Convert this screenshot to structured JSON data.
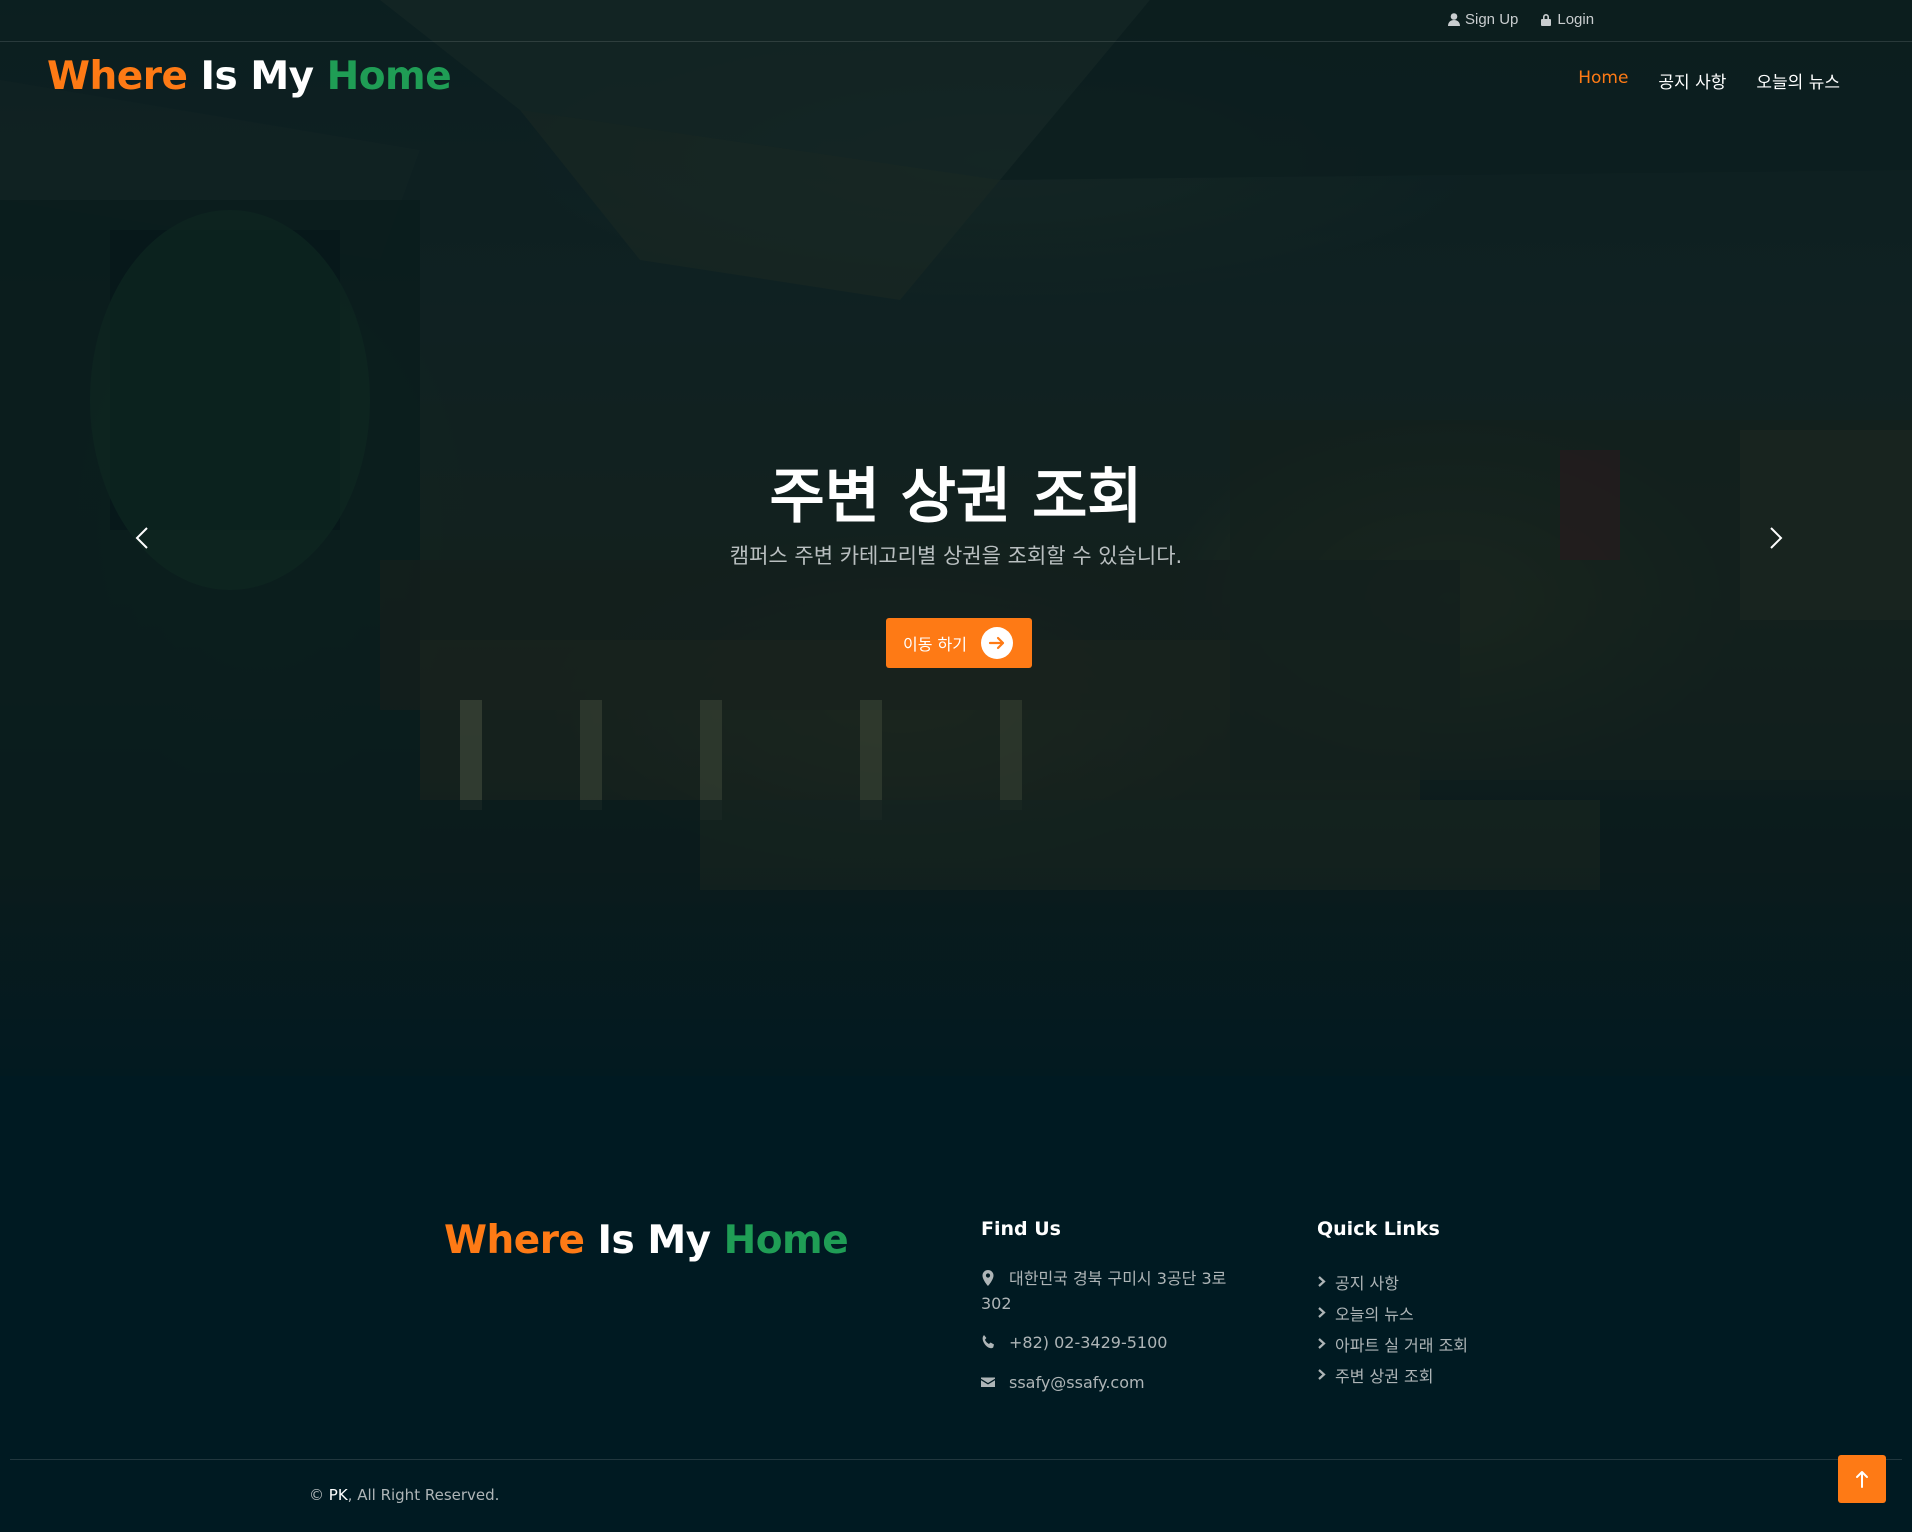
{
  "topbar": {
    "signup_label": "Sign Up",
    "signup_icon": "user-icon",
    "login_label": "Login",
    "login_icon": "lock-icon"
  },
  "brand": {
    "word1": "Where",
    "word2": "Is",
    "word3": "My",
    "word4": "Home"
  },
  "nav": {
    "items": [
      {
        "label": "Home",
        "active": true
      },
      {
        "label": "공지 사항",
        "active": false
      },
      {
        "label": "오늘의 뉴스",
        "active": false
      }
    ]
  },
  "hero": {
    "title": "주변 상권 조회",
    "subtitle": "캠퍼스 주변 카테고리별 상권을 조회할 수 있습니다.",
    "button_label": "이동 하기",
    "button_icon": "arrow-right-icon",
    "prev_icon": "chevron-left-icon",
    "next_icon": "chevron-right-icon"
  },
  "footer": {
    "brand": {
      "word1": "Where",
      "word2": "Is",
      "word3": "My",
      "word4": "Home"
    },
    "find_us": {
      "title": "Find Us",
      "address": "대한민국 경북 구미시 3공단 3로 302",
      "phone": "+82) 02-3429-5100",
      "email": "ssafy@ssafy.com"
    },
    "quick_links": {
      "title": "Quick Links",
      "items": [
        "공지 사항",
        "오늘의 뉴스",
        "아파트 실 거래 조회",
        "주변 상권 조회"
      ]
    },
    "copyright": {
      "prefix": "© ",
      "owner": "PK",
      "suffix": ", All Right Reserved."
    }
  },
  "colors": {
    "accent": "#fe7a15",
    "brand_green": "#1f9d55",
    "background": "#001a22"
  }
}
